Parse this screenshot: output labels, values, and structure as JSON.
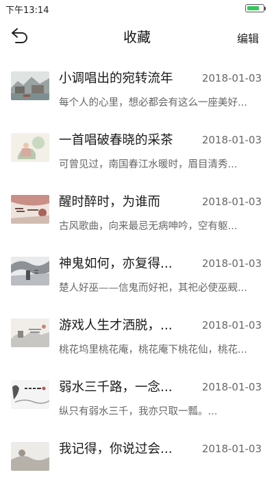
{
  "status": {
    "time": "下午13:14",
    "battery_level": 0.8
  },
  "nav": {
    "title": "收藏",
    "edit_label": "编辑"
  },
  "items": [
    {
      "title": "小调唱出的宛转流年",
      "date": "2018-01-03",
      "desc": "每个人的心里，想必都会有这么一座美好..."
    },
    {
      "title": "一首唱破春晓的采茶",
      "date": "2018-01-03",
      "desc": "可曾见过，南国春江水暖时，眉目清秀..."
    },
    {
      "title": "醒时醉时，为谁而",
      "date": "2018-01-03",
      "desc": "古风歌曲，向来最忌无病呻吟，空有躯..."
    },
    {
      "title": "神鬼如何，亦复得...",
      "date": "2018-01-03",
      "desc": "楚人好巫——信鬼而好祀，其祀必使巫觋..."
    },
    {
      "title": "游戏人生才洒脱，...",
      "date": "2018-01-03",
      "desc": "桃花坞里桃花庵，桃花庵下桃花仙，桃花..."
    },
    {
      "title": "弱水三千路，一念...",
      "date": "2018-01-03",
      "desc": "纵只有弱水三千，我亦只取一瓢。..."
    },
    {
      "title": "我记得，你说过会...",
      "date": "2018-01-03",
      "desc": ""
    }
  ]
}
